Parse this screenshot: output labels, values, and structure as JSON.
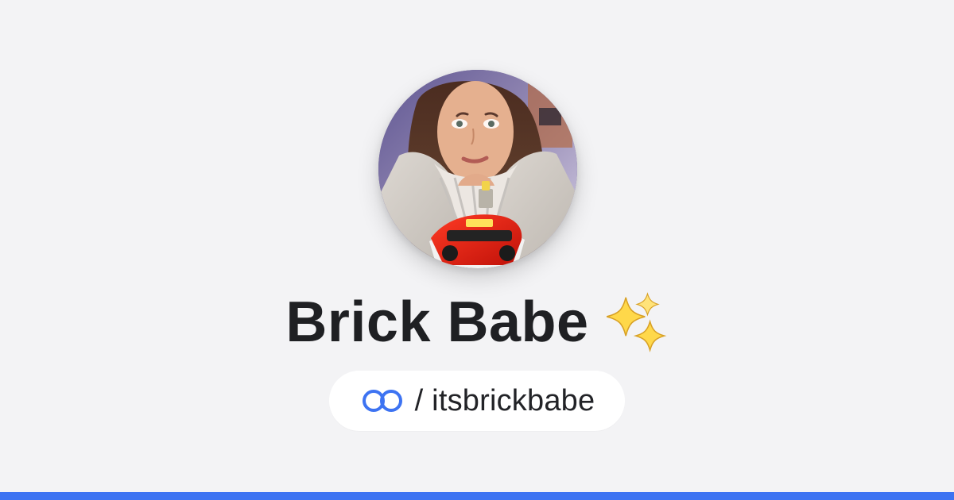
{
  "profile": {
    "name": "Brick Babe",
    "handle_prefix": "/ ",
    "handle": "itsbrickbabe"
  },
  "icons": {
    "title_icon": "sparkles-icon",
    "pill_icon": "linked-rings-icon"
  },
  "colors": {
    "background": "#f3f3f5",
    "title": "#1f2023",
    "accent": "#3d73f2",
    "pill_background": "#ffffff"
  }
}
